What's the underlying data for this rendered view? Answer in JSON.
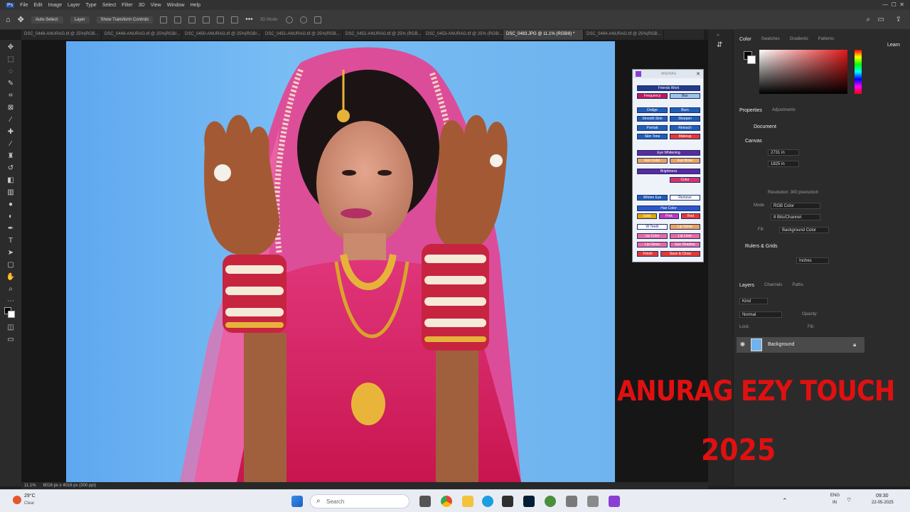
{
  "menu": [
    "Ps",
    "File",
    "Edit",
    "Image",
    "Layer",
    "Type",
    "Select",
    "Filter",
    "3D",
    "View",
    "Window",
    "Help"
  ],
  "optionbar": {
    "auto_select": "Auto-Select:",
    "layer": "Layer",
    "transform": "Show Transform Controls",
    "threed": "3D Mode:"
  },
  "doc_tabs": [
    "DSC_0448-ANURAG.tif @ 25%(RGB...",
    "DSC_0449-ANURAG.tif @ 25%(RGB/...",
    "DSC_0450-ANURAG.tif @ 25%(RGB/...",
    "DSC_0451-ANURAG.tif @ 25%(RGB...",
    "DSC_0452-ANURAG.tif @ 25% (RGB...",
    "DSC_0453-ANURAG.tif @ 25% (RGB/...",
    "DSC_0483.JPG @ 11.1% (RGB/8) *",
    "DSC_0484-ANURAG.tif @ 25%(RGB..."
  ],
  "status": {
    "zoom": "11.1%",
    "size": "6016 px x 4016 px (300 ppi)"
  },
  "plugin": {
    "title": "ANURAG",
    "section_frequency": "Friends Work",
    "btn_frequency": "Frequency",
    "btn_blur": "Blur",
    "btn_dodge": "Dodge",
    "btn_burn": "Burn",
    "btn_smooth_skin": "Smooth Skin",
    "btn_sharpen": "Sharpen",
    "btn_portrait": "Portrait",
    "btn_retouch": "Retouch",
    "btn_skin_tone": "Skin Tone",
    "btn_makeup": "Makeup",
    "section_eye": "Eye Whitening",
    "section_brightness": "Brightness",
    "btn_eye_color": "Eye Color",
    "btn_eye_brow": "Eye Brow",
    "btn_color": "Color",
    "btn_whiten_eye": "Whiten Eye",
    "btn_remove": "Remove",
    "section_hair": "Hair Color",
    "btn_gold": "Gold",
    "btn_pink": "Pink",
    "btn_red": "Red",
    "btn_w_teeth": "W Teeth",
    "btn_lip_shine": "Lip Shine",
    "btn_lip_color": "Lip Color",
    "btn_lip_liner": "Lip Liner",
    "btn_lip_gloss": "Lip Gloss",
    "btn_eye_shadow": "Eye Shadow",
    "btn_finish": "Finish",
    "btn_save_close": "Save & Close"
  },
  "panel": {
    "top_tabs": [
      "Color",
      "Swatches",
      "Gradients",
      "Patterns"
    ],
    "props_tabs": [
      "Properties",
      "Adjustments"
    ],
    "doc_label": "Document",
    "canvas_label": "Canvas",
    "w_value": "2731 in",
    "h_value": "1825 in",
    "resolution": "Resolution: 300 pixels/inch",
    "mode_label": "Mode",
    "mode_value": "RGB Color",
    "bits_value": "8 Bits/Channel",
    "fill_label": "Fill",
    "fill_value": "Background Color",
    "rulers_label": "Rulers & Grids",
    "units_value": "Inches",
    "layers_tabs": [
      "Layers",
      "Channels",
      "Paths"
    ],
    "kind_label": "Kind",
    "normal_label": "Normal",
    "opacity_label": "Opacity:",
    "lock_label": "Lock:",
    "fill2_label": "Fill:",
    "layer_name": "Background",
    "learn": "Learn"
  },
  "watermark": {
    "line1": "ANURAG EZY TOUCH",
    "line2": "2025"
  },
  "taskbar": {
    "weather_temp": "29°C",
    "weather_text": "Clear",
    "search_placeholder": "Search",
    "lang1": "ENG",
    "lang2": "IN",
    "time": "09:30",
    "date": "22-05-2025"
  },
  "colors": {
    "accent_red": "#e01010",
    "panel_bg": "#2b2b2b",
    "canvas_bg": "#6fb3ef"
  }
}
